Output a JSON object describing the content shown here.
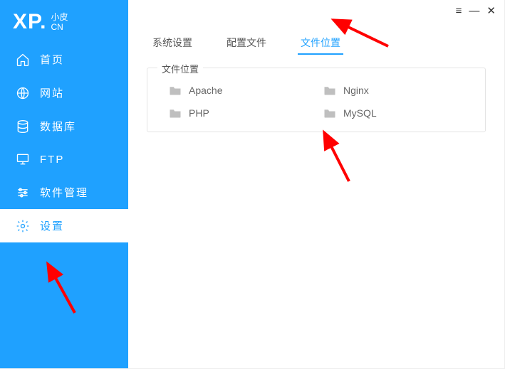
{
  "logo": {
    "big": "XP.",
    "small1": "小皮",
    "small2": "CN"
  },
  "sidebar": {
    "items": [
      {
        "label": "首页"
      },
      {
        "label": "网站"
      },
      {
        "label": "数据库"
      },
      {
        "label": "FTP"
      },
      {
        "label": "软件管理"
      },
      {
        "label": "设置"
      }
    ]
  },
  "tabs": [
    {
      "label": "系统设置"
    },
    {
      "label": "配置文件"
    },
    {
      "label": "文件位置"
    }
  ],
  "panel": {
    "title": "文件位置"
  },
  "folders": [
    {
      "label": "Apache"
    },
    {
      "label": "Nginx"
    },
    {
      "label": "PHP"
    },
    {
      "label": "MySQL"
    }
  ],
  "window_controls": {
    "menu": "≡",
    "minimize": "—",
    "close": "✕"
  }
}
